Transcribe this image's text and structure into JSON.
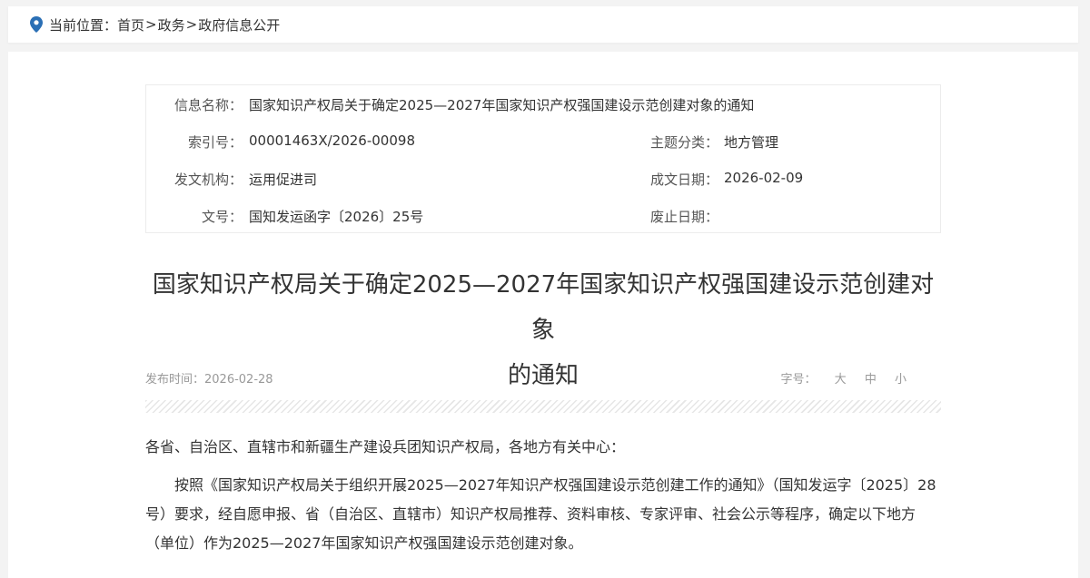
{
  "breadcrumb": {
    "label": "当前位置：",
    "items": [
      "首页",
      "政务",
      "政府信息公开"
    ],
    "separator": ">"
  },
  "info": {
    "name_label": "信息名称：",
    "name_value": "国家知识产权局关于确定2025—2027年国家知识产权强国建设示范创建对象的通知",
    "index_label": "索引号：",
    "index_value": "00001463X/2026-00098",
    "topic_label": "主题分类：",
    "topic_value": "地方管理",
    "org_label": "发文机构：",
    "org_value": "运用促进司",
    "date_label": "成文日期：",
    "date_value": "2026-02-09",
    "docno_label": "文号：",
    "docno_value": "国知发运函字〔2026〕25号",
    "abolish_label": "废止日期：",
    "abolish_value": ""
  },
  "article": {
    "title_line1": "国家知识产权局关于确定2025—2027年国家知识产权强国建设示范创建对象",
    "title_line2": "的通知",
    "publish_label": "发布时间：",
    "publish_date": "2026-02-28",
    "font_size_label": "字号：",
    "font_large": "大",
    "font_medium": "中",
    "font_small": "小",
    "salutation": "各省、自治区、直辖市和新疆生产建设兵团知识产权局，各地方有关中心：",
    "paragraph1": "按照《国家知识产权局关于组织开展2025—2027年知识产权强国建设示范创建工作的通知》（国知发运字〔2025〕28号）要求，经自愿申报、省（自治区、直辖市）知识产权局推荐、资料审核、专家评审、社会公示等程序，确定以下地方（单位）作为2025—2027年国家知识产权强国建设示范创建对象。"
  },
  "colors": {
    "pin": "#2a6fb5",
    "background": "#f3f3f3"
  }
}
